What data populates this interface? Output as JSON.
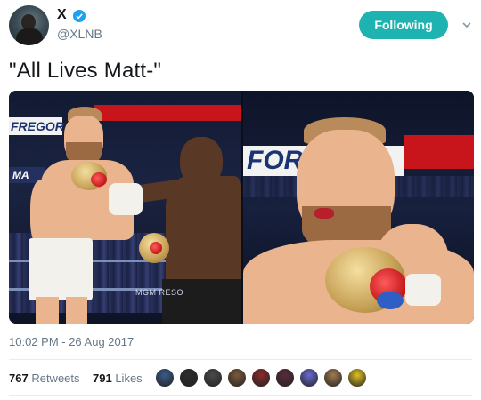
{
  "tweet": {
    "author": {
      "name": "X",
      "handle": "@XLNB",
      "verified": true
    },
    "follow_button_label": "Following",
    "text": "\"All Lives Matt-\"",
    "timestamp": "10:02 PM - 26 Aug 2017",
    "stats": {
      "retweets_count": "767",
      "retweets_label": "Retweets",
      "likes_count": "791",
      "likes_label": "Likes"
    },
    "media": {
      "left_photo": {
        "banner_text": "FREGOR",
        "ring_text": "MGM RESO"
      },
      "right_photo": {
        "banner_text": "FOR"
      }
    },
    "liker_avatar_colors": [
      "#3b5b8a",
      "#2d2d2d",
      "#4a4a4a",
      "#7b5a3c",
      "#8a2a2a",
      "#5a2a3a",
      "#6a6ad0",
      "#a07a50",
      "#e0c020"
    ]
  },
  "colors": {
    "accent": "#1eb3b1",
    "verified_blue": "#1da1f2",
    "muted_text": "#657786"
  }
}
